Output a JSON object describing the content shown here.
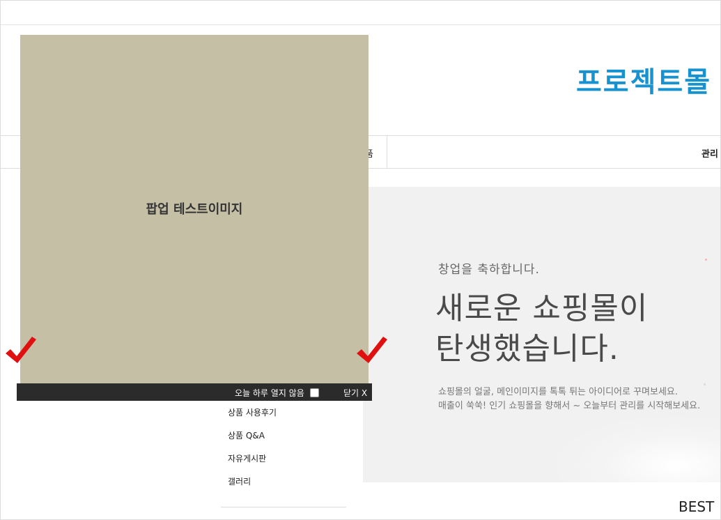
{
  "header": {
    "logo_text": "프로젝트몰"
  },
  "nav": {
    "partial_item": "품",
    "admin_item": "관리"
  },
  "banner": {
    "small_text": "창업을 축하합니다.",
    "headline_line1": "새로운 쇼핑몰이",
    "headline_line2": "탄생했습니다.",
    "desc_line1": "쇼핑몰의 얼굴, 메인이미지를 톡톡 튀는 아이디어로 꾸며보세요.",
    "desc_line2": "매출이 쑥쑥! 인기 쇼핑몰을 향해서 ~ 오늘부터 관리를 시작해보세요."
  },
  "dropdown": {
    "items": [
      "상품 사용후기",
      "상품 Q&A",
      "자유게시판",
      "갤러리"
    ]
  },
  "best": {
    "label": "BEST"
  },
  "popup": {
    "image_text": "팝업 테스트이미지",
    "no_show_label": "오늘 하루 열지 않음",
    "no_show_checked": false,
    "close_label": "닫기 X"
  },
  "colors": {
    "logo": "#1592cf",
    "popup_bg": "#c5bfa6",
    "popup_bar": "#2b2b2b",
    "checkmark": "#e01010",
    "banner_bg": "#f1f1f1"
  },
  "icons": {
    "annotation_marks": [
      "checkmark-icon",
      "checkmark-icon"
    ]
  }
}
